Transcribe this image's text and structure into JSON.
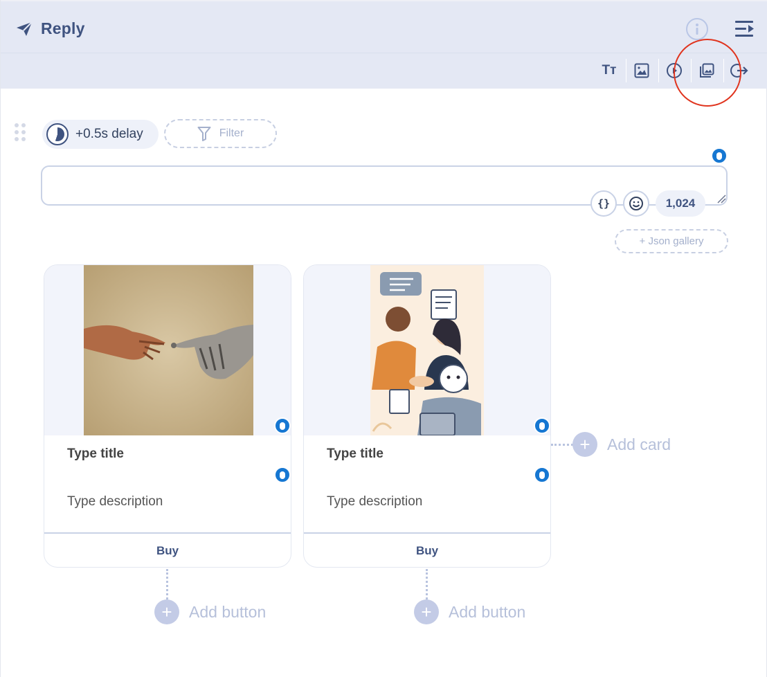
{
  "header": {
    "title": "Reply",
    "icon": "send-icon"
  },
  "toolbar": {
    "tools": [
      "text-icon",
      "image-icon",
      "video-icon",
      "gallery-icon",
      "exit-icon"
    ],
    "text_tool_label": "Tт"
  },
  "delay": {
    "label": "+0.5s delay"
  },
  "filter": {
    "label": "Filter"
  },
  "message": {
    "value": "",
    "placeholder": ""
  },
  "message_tools": {
    "variable_label": "{}",
    "char_count": "1,024"
  },
  "json_gallery": {
    "label": "+ Json gallery"
  },
  "cards": [
    {
      "image": "hands-touching-robot-image",
      "title": "Type title",
      "description": "Type description",
      "button": "Buy",
      "add_button": "Add button"
    },
    {
      "image": "people-and-robot-chat-image",
      "title": "Type title",
      "description": "Type description",
      "button": "Buy",
      "add_button": "Add button"
    }
  ],
  "add_card": {
    "label": "Add card"
  },
  "colors": {
    "header_bg": "#e4e8f4",
    "accent": "#3f5380",
    "badge": "#1677d2",
    "highlight": "#e0341e"
  }
}
